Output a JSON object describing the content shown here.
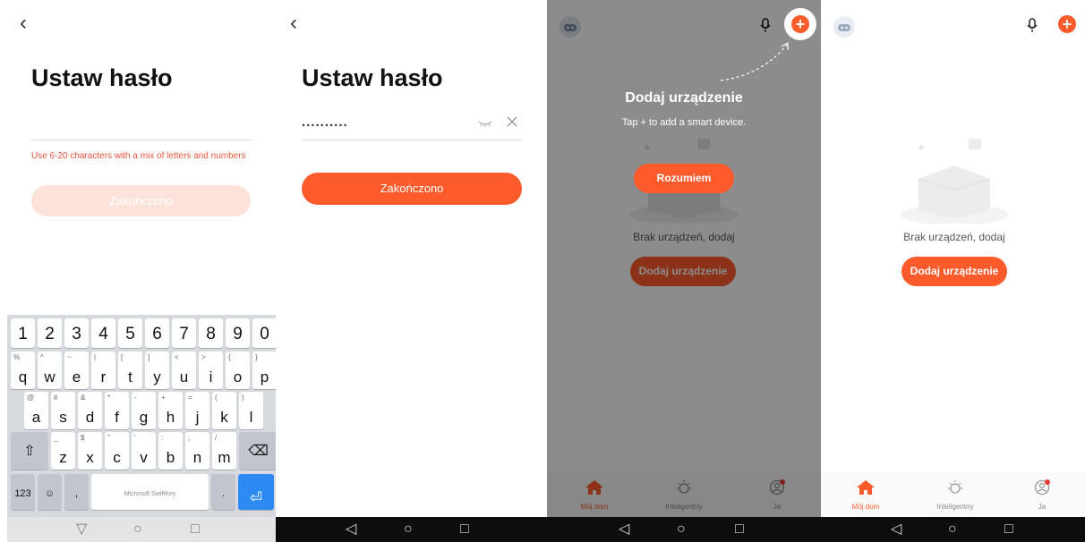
{
  "screen1": {
    "back_glyph": "‹",
    "title": "Ustaw hasło",
    "hint": "Use 6-20 characters with a mix of letters and numbers",
    "done_label": "Zakończono",
    "keyboard": {
      "number_row": [
        "1",
        "2",
        "3",
        "4",
        "5",
        "6",
        "7",
        "8",
        "9",
        "0"
      ],
      "row1": [
        {
          "k": "q",
          "a": "%"
        },
        {
          "k": "w",
          "a": "^"
        },
        {
          "k": "e",
          "a": "~"
        },
        {
          "k": "r",
          "a": "|"
        },
        {
          "k": "t",
          "a": "["
        },
        {
          "k": "y",
          "a": "]"
        },
        {
          "k": "u",
          "a": "<"
        },
        {
          "k": "i",
          "a": ">"
        },
        {
          "k": "o",
          "a": "{"
        },
        {
          "k": "p",
          "a": "}"
        }
      ],
      "row2": [
        {
          "k": "a",
          "a": "@"
        },
        {
          "k": "s",
          "a": "#"
        },
        {
          "k": "d",
          "a": "&"
        },
        {
          "k": "f",
          "a": "*"
        },
        {
          "k": "g",
          "a": "-"
        },
        {
          "k": "h",
          "a": "+"
        },
        {
          "k": "j",
          "a": "="
        },
        {
          "k": "k",
          "a": "("
        },
        {
          "k": "l",
          "a": ")"
        }
      ],
      "row3": [
        {
          "k": "z",
          "a": "_"
        },
        {
          "k": "x",
          "a": "$"
        },
        {
          "k": "c",
          "a": "\""
        },
        {
          "k": "v",
          "a": "'"
        },
        {
          "k": "b",
          "a": ":"
        },
        {
          "k": "n",
          "a": ";"
        },
        {
          "k": "m",
          "a": "/"
        }
      ],
      "shift_glyph": "⇧",
      "backspace_glyph": "⌫",
      "numbers_label": "123",
      "emoji_glyph": "☺",
      "comma_label": ",",
      "comma_alt": "🎤",
      "space_label": "Microsoft SwiftKey",
      "period_label": ".",
      "period_alt": ",!?",
      "enter_glyph": "⏎"
    },
    "nav": {
      "back": "▽",
      "home": "○",
      "recent": "□"
    }
  },
  "screen2": {
    "back_glyph": "‹",
    "title": "Ustaw hasło",
    "password_mask": "..........",
    "done_label": "Zakończono",
    "nav": {
      "back": "◁",
      "home": "○",
      "recent": "□"
    }
  },
  "screen3": {
    "tip_title": "Dodaj urządzenie",
    "tip_subtitle": "Tap + to add a smart device.",
    "ok_label": "Rozumiem",
    "empty_text": "Brak urządzeń, dodaj",
    "add_label": "Dodaj urządzenie",
    "tabs": [
      {
        "label": "Mój dom"
      },
      {
        "label": "Inteligentny"
      },
      {
        "label": "Ja"
      }
    ],
    "nav": {
      "back": "◁",
      "home": "○",
      "recent": "□"
    }
  },
  "screen4": {
    "empty_text": "Brak urządzeń, dodaj",
    "add_label": "Dodaj urządzenie",
    "plus_glyph": "+",
    "tabs": [
      {
        "label": "Mój dom"
      },
      {
        "label": "Inteligentny"
      },
      {
        "label": "Ja"
      }
    ],
    "nav": {
      "back": "◁",
      "home": "○",
      "recent": "□"
    }
  },
  "colors": {
    "accent": "#fd5b2c",
    "accent_disabled": "#fde2da",
    "error": "#e8533a",
    "keyboard_bg": "#d6d9de",
    "enter_key": "#2d8af0"
  }
}
